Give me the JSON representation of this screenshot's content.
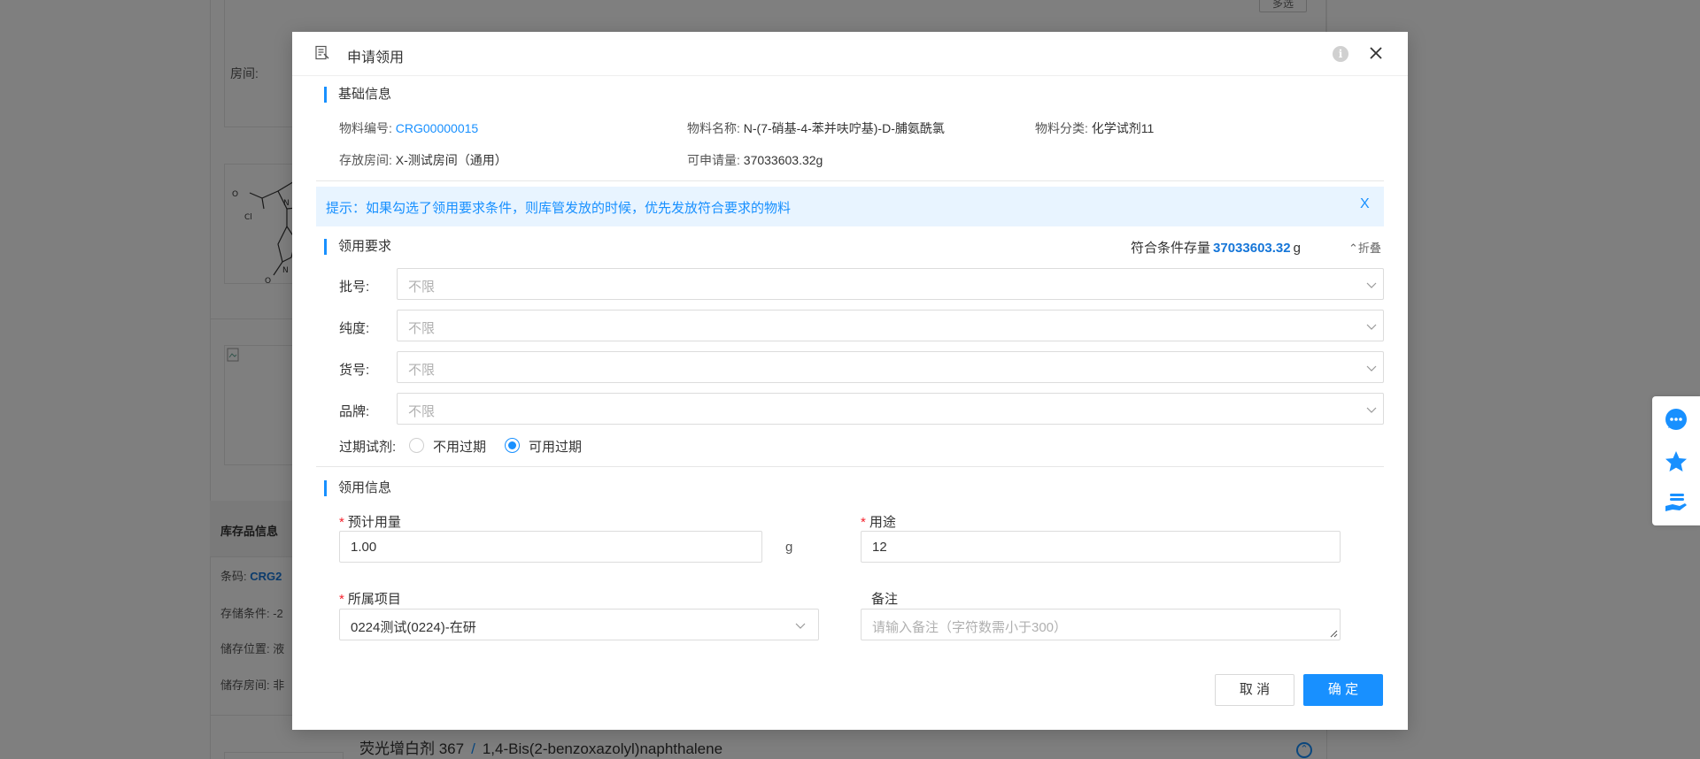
{
  "background": {
    "room_label": "房间:",
    "multi_button": "多选",
    "stock_info_title": "库存品信息",
    "barcode_label": "条码:",
    "barcode_value": "CRG2",
    "storage_condition": "存储条件: -2",
    "storage_location": "储存位置: 液",
    "storage_room": "储存房间: 非",
    "bottom_name_cn": "荧光增白剂 367",
    "bottom_sep": "/",
    "bottom_name_en": "1,4-Bis(2-benzoxazolyl)naphthalene"
  },
  "dialog": {
    "title": "申请领用",
    "close_glyph": "×",
    "info_glyph": "i",
    "basic_section": "基础信息",
    "material_code_label": "物料编号:",
    "material_code_value": "CRG00000015",
    "material_name_label": "物料名称:",
    "material_name_value": "N-(7-硝基-4-苯并呋咛基)-D-脯氨酰氯",
    "material_category_label": "物料分类:",
    "material_category_value": "化学试剂11",
    "room_label": "存放房间:",
    "room_value": "X-测试房间（通用）",
    "available_label": "可申请量:",
    "available_value": "37033603.32g",
    "tip": "提示：如果勾选了领用要求条件，则库管发放的时候，优先发放符合要求的物料",
    "tip_close": "X",
    "requirement_section": "领用要求",
    "eligible_stock_label": "符合条件存量",
    "eligible_stock_value": "37033603.32",
    "eligible_stock_unit": "g",
    "fold_label": "⌃折叠",
    "fields": [
      {
        "label": "批号:",
        "placeholder": "不限"
      },
      {
        "label": "纯度:",
        "placeholder": "不限"
      },
      {
        "label": "货号:",
        "placeholder": "不限"
      },
      {
        "label": "品牌:",
        "placeholder": "不限"
      }
    ],
    "expired_label": "过期试剂:",
    "expired_options": [
      "不用过期",
      "可用过期"
    ],
    "expired_selected": "可用过期",
    "apply_section": "领用信息",
    "required_mark": "*",
    "amount_label": "预计用量",
    "amount_value": "1.00",
    "amount_unit": "g",
    "purpose_label": "用途",
    "purpose_value": "12",
    "project_label": "所属项目",
    "project_value": "0224测试(0224)-在研",
    "remark_label": "备注",
    "remark_placeholder": "请输入备注（字符数需小于300）",
    "cancel_label": "取 消",
    "ok_label": "确 定"
  },
  "toolbar": {
    "icons": [
      "chat-icon",
      "star-icon",
      "hand-coin-icon"
    ],
    "accent": "#1890ff"
  }
}
